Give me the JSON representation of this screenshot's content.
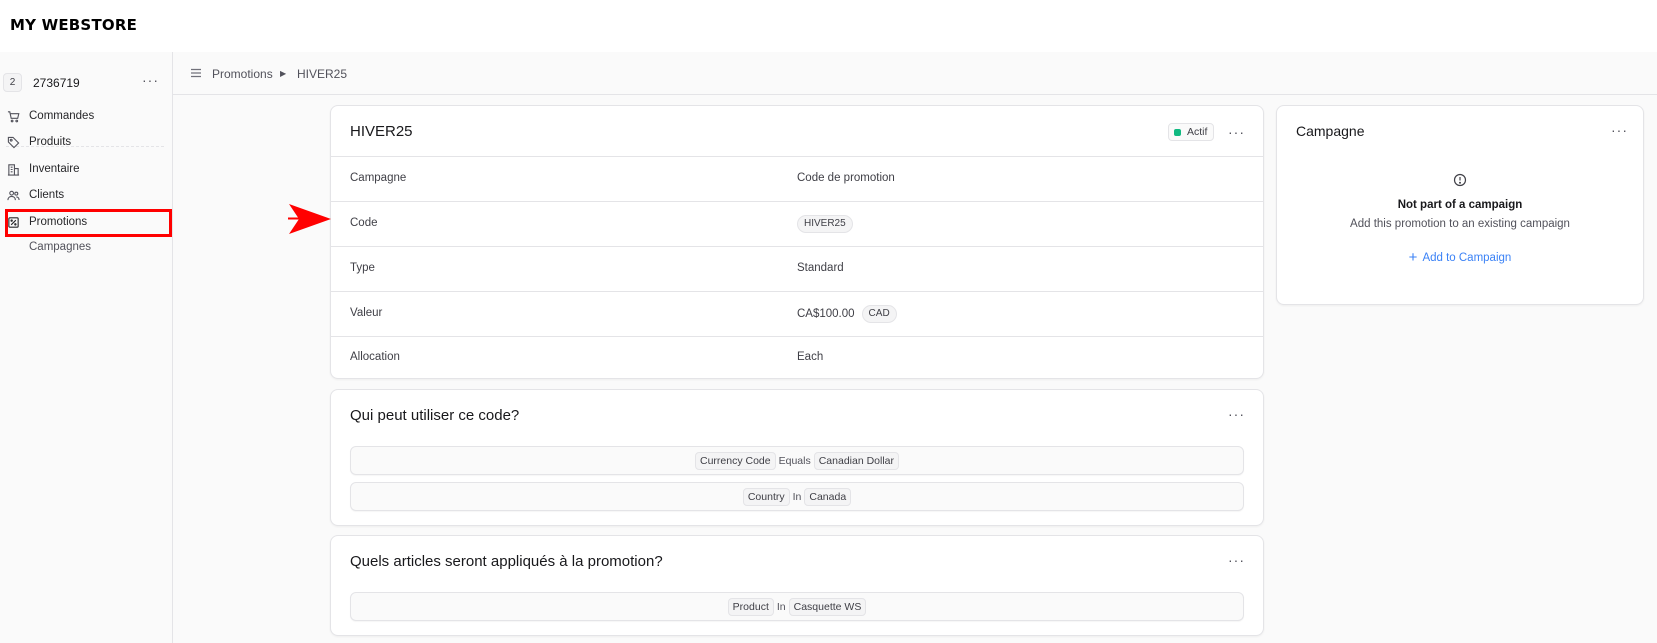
{
  "brand": "MY WEBSTORE",
  "store": {
    "badge": "2",
    "name": "2736719",
    "more": "···"
  },
  "sidebar": {
    "items": [
      {
        "label": "Commandes",
        "icon": "cart-icon"
      },
      {
        "label": "Produits",
        "icon": "tag-icon"
      },
      {
        "label": "Inventaire",
        "icon": "building-icon"
      },
      {
        "label": "Clients",
        "icon": "users-icon"
      },
      {
        "label": "Promotions",
        "icon": "receipt-percent-icon"
      }
    ],
    "sub_items": [
      {
        "label": "Campagnes"
      }
    ]
  },
  "breadcrumb": {
    "items": [
      "Promotions",
      "HIVER25"
    ]
  },
  "promotion": {
    "title": "HIVER25",
    "status": "Actif",
    "status_color": "#10b981",
    "more": "···",
    "rows": [
      {
        "label": "Campagne",
        "value": "Code de promotion"
      },
      {
        "label": "Code",
        "value": "HIVER25"
      },
      {
        "label": "Type",
        "value": "Standard"
      },
      {
        "label": "Valeur",
        "value": "CA$100.00",
        "currency": "CAD"
      },
      {
        "label": "Allocation",
        "value": "Each"
      }
    ]
  },
  "who": {
    "title": "Qui peut utiliser ce code?",
    "more": "···",
    "rules": [
      {
        "attribute": "Currency Code",
        "operator": "Equals",
        "value": "Canadian Dollar"
      },
      {
        "attribute": "Country",
        "operator": "In",
        "value": "Canada"
      }
    ]
  },
  "items": {
    "title": "Quels articles seront appliqués à la promotion?",
    "more": "···",
    "rules": [
      {
        "attribute": "Product",
        "operator": "In",
        "value": "Casquette WS"
      }
    ]
  },
  "campaign": {
    "title": "Campagne",
    "more": "···",
    "empty_title": "Not part of a campaign",
    "empty_subtitle": "Add this promotion to an existing campaign",
    "add_label": "Add to Campaign",
    "add_plus": "+",
    "accent": "#3b82f6"
  },
  "annotations": {
    "highlight_color": "#ff0000"
  }
}
